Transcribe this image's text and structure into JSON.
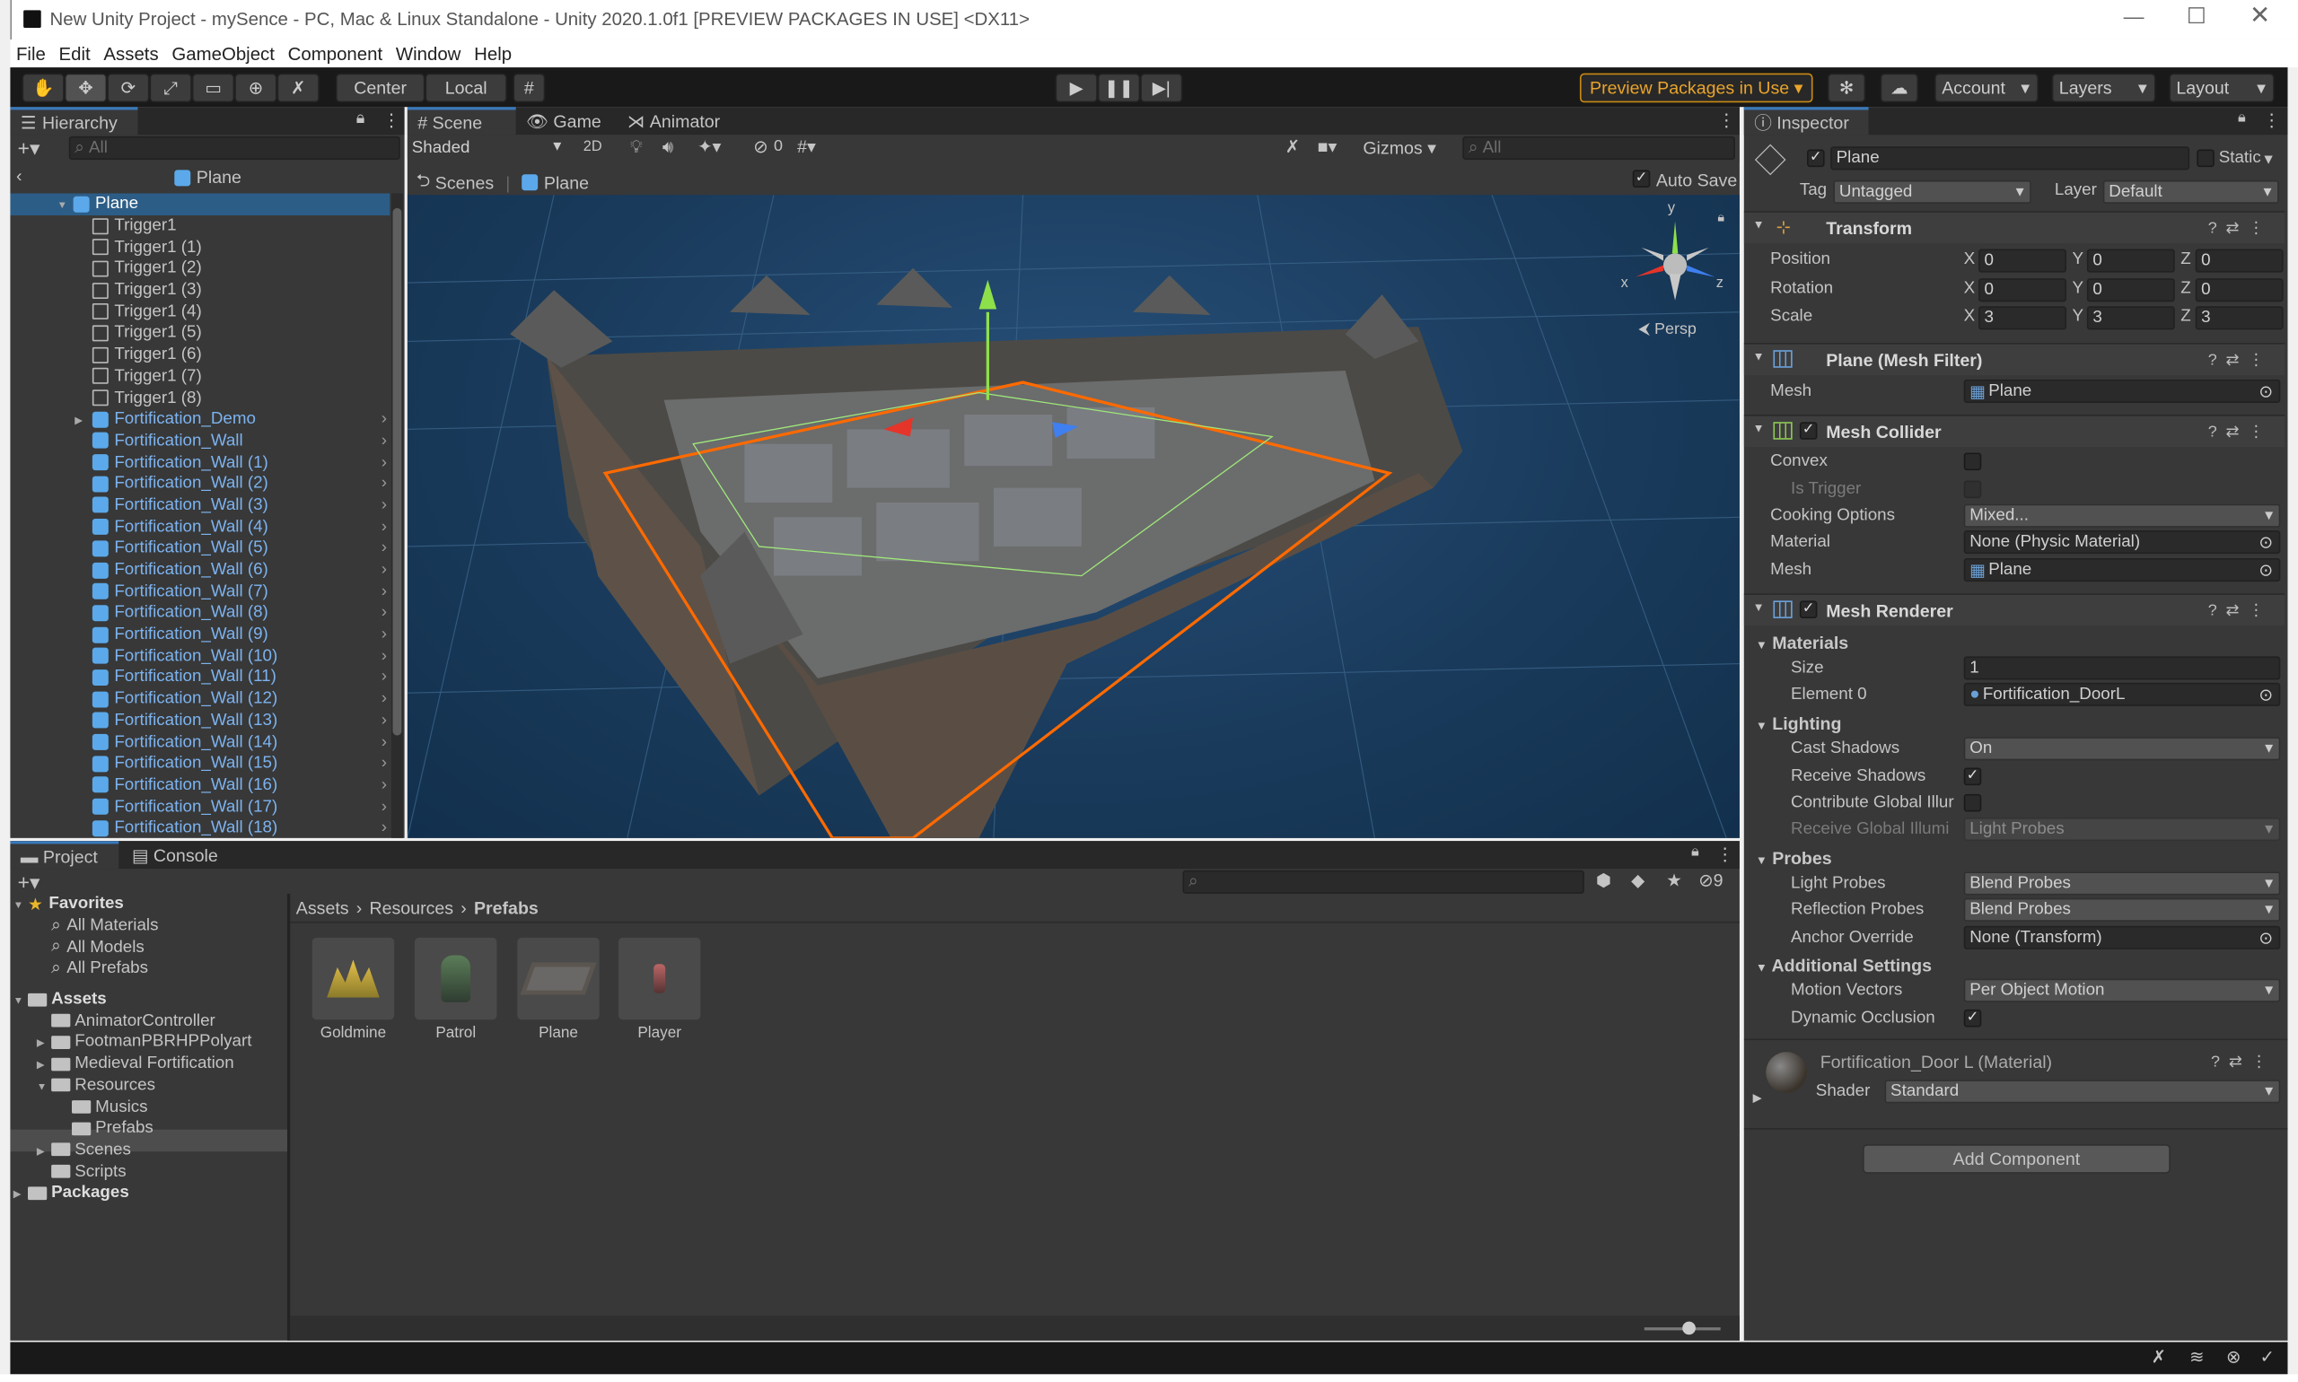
{
  "window": {
    "title": "New Unity Project - mySence - PC, Mac & Linux Standalone - Unity 2020.1.0f1 [PREVIEW PACKAGES IN USE] <DX11>"
  },
  "menu": [
    "File",
    "Edit",
    "Assets",
    "GameObject",
    "Component",
    "Window",
    "Help"
  ],
  "toolbar": {
    "center": "Center",
    "local": "Local",
    "preview": "Preview Packages in Use",
    "account": "Account",
    "layers": "Layers",
    "layout": "Layout"
  },
  "hierarchy": {
    "tab": "Hierarchy",
    "search": "All",
    "scene": "Plane",
    "root": "Plane",
    "triggers": [
      "Trigger1",
      "Trigger1 (1)",
      "Trigger1 (2)",
      "Trigger1 (3)",
      "Trigger1 (4)",
      "Trigger1 (5)",
      "Trigger1 (6)",
      "Trigger1 (7)",
      "Trigger1 (8)"
    ],
    "prefabs": [
      "Fortification_Demo",
      "Fortification_Wall",
      "Fortification_Wall (1)",
      "Fortification_Wall (2)",
      "Fortification_Wall (3)",
      "Fortification_Wall (4)",
      "Fortification_Wall (5)",
      "Fortification_Wall (6)",
      "Fortification_Wall (7)",
      "Fortification_Wall (8)",
      "Fortification_Wall (9)",
      "Fortification_Wall (10)",
      "Fortification_Wall (11)",
      "Fortification_Wall (12)",
      "Fortification_Wall (13)",
      "Fortification_Wall (14)",
      "Fortification_Wall (15)",
      "Fortification_Wall (16)",
      "Fortification_Wall (17)",
      "Fortification_Wall (18)"
    ]
  },
  "scene": {
    "tabs": [
      "Scene",
      "Game",
      "Animator"
    ],
    "shading": "Shaded",
    "mode2d": "2D",
    "hidden": "0",
    "gizmos": "Gizmos",
    "search": "All",
    "crumb_scenes": "Scenes",
    "crumb_plane": "Plane",
    "autosave": "Auto Save",
    "persp": "Persp",
    "axis_y": "y",
    "axis_x": "x",
    "axis_z": "z"
  },
  "project": {
    "tabs": [
      "Project",
      "Console"
    ],
    "hidden_count": "9",
    "favorites": "Favorites",
    "fav_items": [
      "All Materials",
      "All Models",
      "All Prefabs"
    ],
    "assets": "Assets",
    "asset_items": [
      "AnimatorController",
      "FootmanPBRHPPolyart",
      "Medieval Fortification",
      "Resources"
    ],
    "resources_children": [
      "Musics",
      "Prefabs"
    ],
    "more_assets": [
      "Scenes",
      "Scripts"
    ],
    "packages": "Packages",
    "crumbs": [
      "Assets",
      "Resources",
      "Prefabs"
    ],
    "thumbs": [
      "Goldmine",
      "Patrol",
      "Plane",
      "Player"
    ]
  },
  "inspector": {
    "tab": "Inspector",
    "name": "Plane",
    "static": "Static",
    "tag_label": "Tag",
    "tag": "Untagged",
    "layer_label": "Layer",
    "layer": "Default",
    "transform": {
      "title": "Transform",
      "rows": [
        {
          "label": "Position",
          "x": "0",
          "y": "0",
          "z": "0"
        },
        {
          "label": "Rotation",
          "x": "0",
          "y": "0",
          "z": "0"
        },
        {
          "label": "Scale",
          "x": "3",
          "y": "3",
          "z": "3"
        }
      ]
    },
    "meshfilter": {
      "title": "Plane (Mesh Filter)",
      "mesh_label": "Mesh",
      "mesh": "Plane"
    },
    "collider": {
      "title": "Mesh Collider",
      "convex": "Convex",
      "istrigger": "Is Trigger",
      "cooking": "Cooking Options",
      "cooking_val": "Mixed...",
      "material": "Material",
      "material_val": "None (Physic Material)",
      "mesh": "Mesh",
      "mesh_val": "Plane"
    },
    "renderer": {
      "title": "Mesh Renderer",
      "materials": "Materials",
      "size": "Size",
      "size_val": "1",
      "element": "Element 0",
      "element_val": "Fortification_DoorL",
      "lighting": "Lighting",
      "cast": "Cast Shadows",
      "cast_val": "On",
      "receive": "Receive Shadows",
      "contribute": "Contribute Global Illur",
      "receive_gi": "Receive Global Illumi",
      "receive_gi_val": "Light Probes",
      "probes": "Probes",
      "lightprobes": "Light Probes",
      "lightprobes_val": "Blend Probes",
      "reflprobes": "Reflection Probes",
      "reflprobes_val": "Blend Probes",
      "anchor": "Anchor Override",
      "anchor_val": "None (Transform)",
      "additional": "Additional Settings",
      "motion": "Motion Vectors",
      "motion_val": "Per Object Motion",
      "dynocc": "Dynamic Occlusion"
    },
    "material": {
      "title": "Fortification_Door L (Material)",
      "shader_label": "Shader",
      "shader": "Standard"
    },
    "add": "Add Component"
  }
}
